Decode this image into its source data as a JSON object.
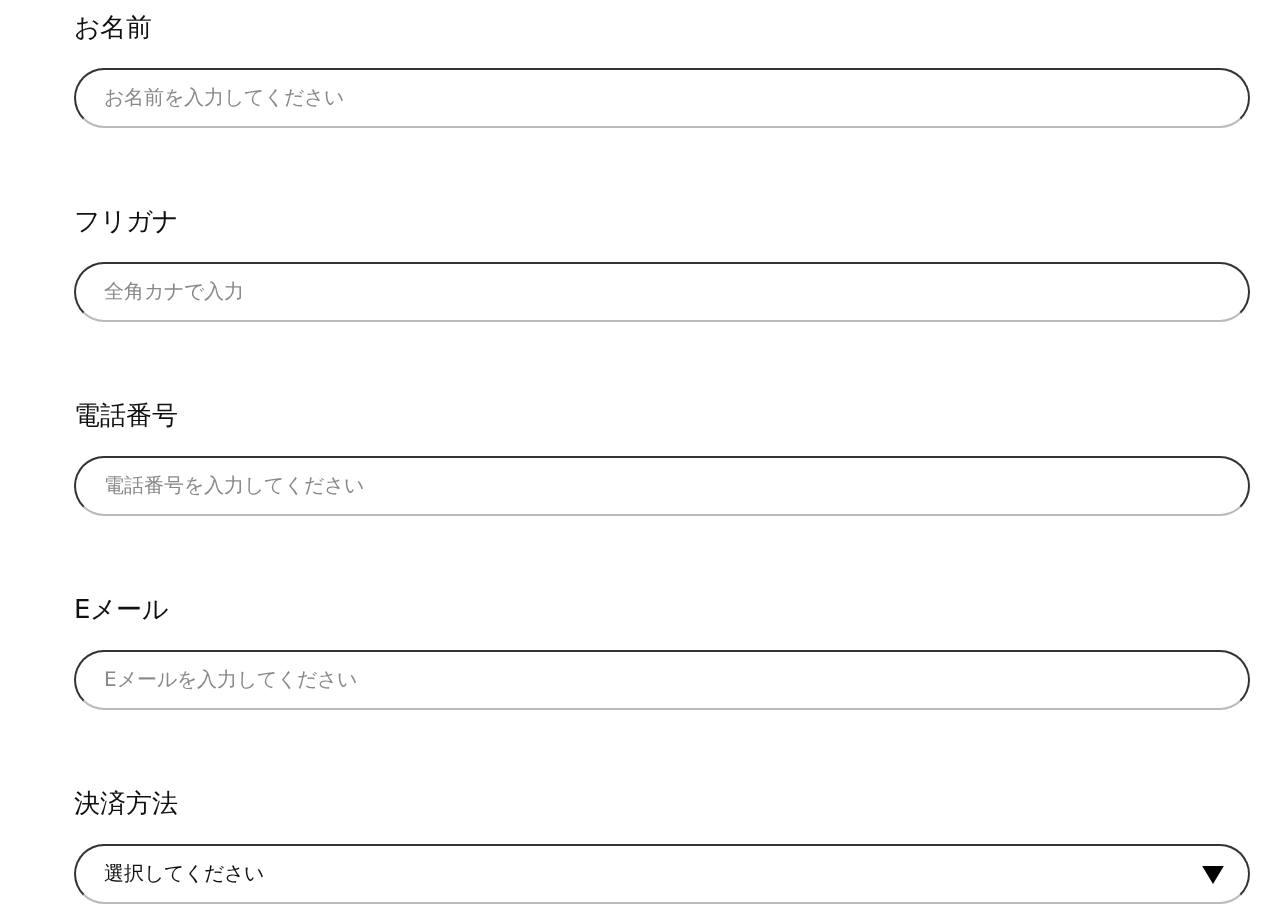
{
  "fields": [
    {
      "kind": "input",
      "label": "お名前",
      "placeholder": "お名前を入力してください"
    },
    {
      "kind": "input",
      "label": "フリガナ",
      "placeholder": "全角カナで入力"
    },
    {
      "kind": "input",
      "label": "電話番号",
      "placeholder": "電話番号を入力してください"
    },
    {
      "kind": "input",
      "label": "Eメール",
      "placeholder": "Eメールを入力してください"
    },
    {
      "kind": "select",
      "label": "決済方法",
      "value": "選択してください"
    }
  ]
}
